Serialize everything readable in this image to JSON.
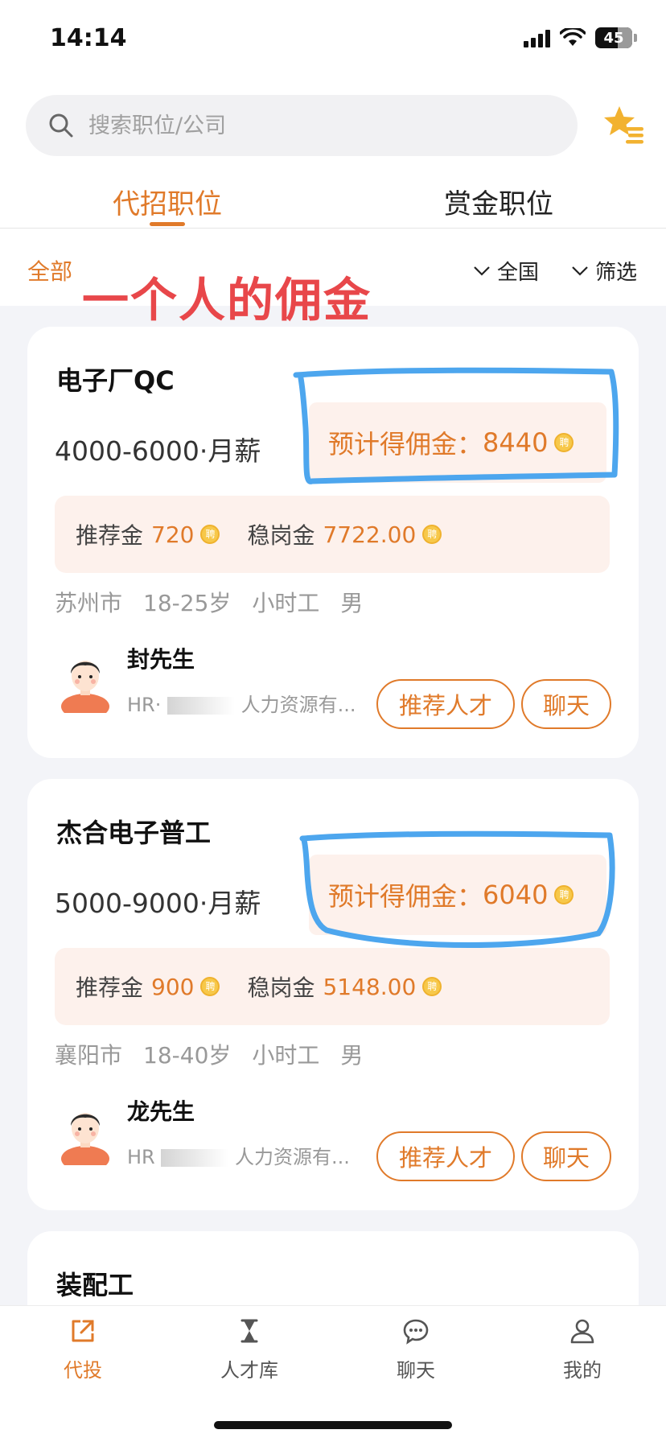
{
  "status_bar": {
    "time": "14:14",
    "battery": "45"
  },
  "search": {
    "placeholder": "搜索职位/公司"
  },
  "tabs": [
    {
      "label": "代招职位"
    },
    {
      "label": "赏金职位"
    }
  ],
  "filters": {
    "all": "全部",
    "region": "全国",
    "screen": "筛选"
  },
  "annotation": "一个人的佣金",
  "jobs": [
    {
      "title": "电子厂QC",
      "salary": "4000-6000·月薪",
      "commission_label": "预计得佣金：",
      "commission": "8440",
      "referral_label": "推荐金",
      "referral": "720",
      "stable_label": "稳岗金",
      "stable": "7722.00",
      "tags": [
        "苏州市",
        "18-25岁",
        "小时工",
        "男"
      ],
      "hr_name": "封先生",
      "hr_prefix": "HR·",
      "hr_company": "人力资源有...",
      "recommend_btn": "推荐人才",
      "chat_btn": "聊天"
    },
    {
      "title": "杰合电子普工",
      "salary": "5000-9000·月薪",
      "commission_label": "预计得佣金：",
      "commission": "6040",
      "referral_label": "推荐金",
      "referral": "900",
      "stable_label": "稳岗金",
      "stable": "5148.00",
      "tags": [
        "襄阳市",
        "18-40岁",
        "小时工",
        "男"
      ],
      "hr_name": "龙先生",
      "hr_prefix": "HR",
      "hr_company": "人力资源有...",
      "recommend_btn": "推荐人才",
      "chat_btn": "聊天"
    },
    {
      "title": "装配工"
    }
  ],
  "coin_icon_text": "聘",
  "nav": [
    {
      "label": "代投"
    },
    {
      "label": "人才库"
    },
    {
      "label": "聊天"
    },
    {
      "label": "我的"
    }
  ],
  "colors": {
    "accent": "#e07a2a",
    "annotation_red": "#e8474a",
    "marker_blue": "#4da6ee"
  }
}
